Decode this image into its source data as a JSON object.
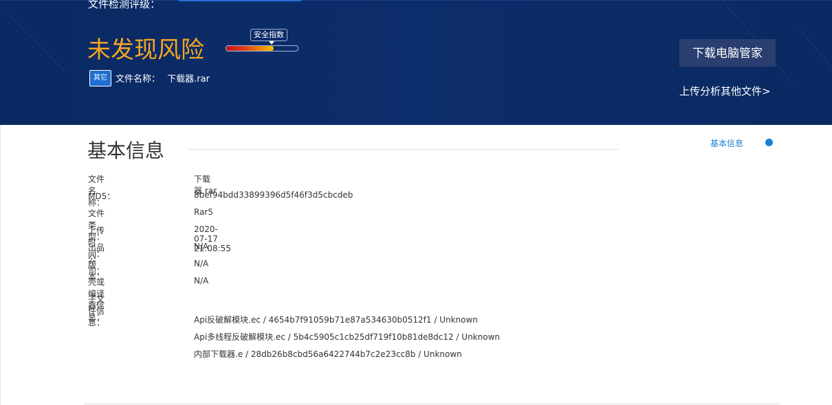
{
  "banner": {
    "detect_label": "文件检测评级：",
    "risk_title": "未发现风险",
    "safety_tag": "安全指数",
    "safety_level": 0.66,
    "file_icon_text": "其它",
    "file_name_label": "文件名称：",
    "file_name_value": "下载器.rar",
    "download_button": "下载电脑管家",
    "upload_link": "上传分析其他文件>"
  },
  "section": {
    "title": "基本信息",
    "nav_link": "基本信息"
  },
  "info": [
    {
      "k": "文件名称：",
      "v": "下载器.rar"
    },
    {
      "k": "MD5：",
      "v": "8bef94bdd33899396d5f46f3d5cbcdeb"
    },
    {
      "k": "文件类型：",
      "v": "Rar5"
    },
    {
      "k": "上传时间：",
      "v": "2020-07-17 21:08:55"
    },
    {
      "k": "出品公司：",
      "v": "N/A"
    },
    {
      "k": "版本：",
      "v": "N/A"
    },
    {
      "k": "壳或编译器信息：",
      "v": "N/A"
    },
    {
      "k": "子文件信息：",
      "v": ""
    }
  ],
  "subfiles": [
    "Api反破解模块.ec /  4654b7f91059b71e87a534630b0512f1 /  Unknown",
    "Api多线程反破解模块.ec /  5b4c5905c1cb25df719f10b81de8dc12 /  Unknown",
    "内部下载器.e /  28db26b8cbd56a6422744b7c2e23cc8b /  Unknown"
  ]
}
